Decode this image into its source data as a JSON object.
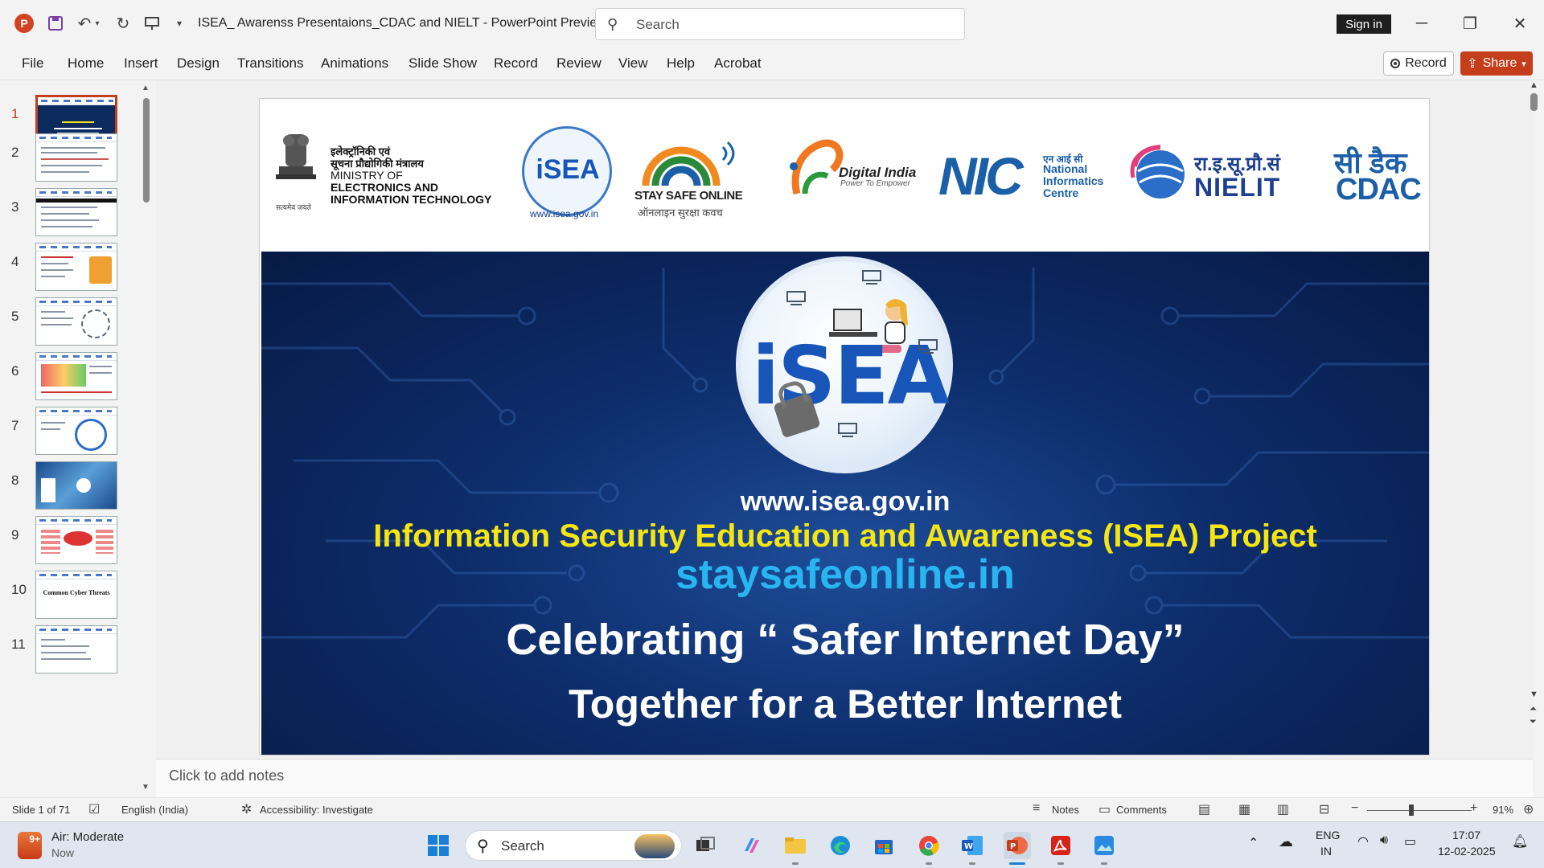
{
  "app": {
    "doc_title": "ISEA_ Awarenss Presentaions_CDAC and NIELT  -  PowerPoint Preview",
    "search_placeholder": "Search",
    "sign_in": "Sign in",
    "logo_letter": "P"
  },
  "ribbon": {
    "tabs": [
      "File",
      "Home",
      "Insert",
      "Design",
      "Transitions",
      "Animations",
      "Slide Show",
      "Record",
      "Review",
      "View",
      "Help",
      "Acrobat"
    ],
    "record_label": "Record",
    "share_label": "Share"
  },
  "thumbnails": {
    "numbers": [
      "1",
      "2",
      "3",
      "4",
      "5",
      "6",
      "7",
      "8",
      "9",
      "10",
      "11"
    ],
    "slide10_title": "Common Cyber Threats"
  },
  "slide": {
    "logos": {
      "ministry_hi1": "इलेक्ट्रॉनिकी एवं",
      "ministry_hi2": "सूचना प्रौद्योगिकी मंत्रालय",
      "ministry_en1": "MINISTRY OF",
      "ministry_en2": "ELECTRONICS AND",
      "ministry_en3": "INFORMATION TECHNOLOGY",
      "emblem_caption": "सत्यमेव जयते",
      "isea_small": "iSEA",
      "isea_url_small": "www.isea.gov.in",
      "sso_caption": "STAY SAFE ONLINE",
      "sso_caption_hi": "ऑनलाइन सुरक्षा कवच",
      "digital_india": "Digital India",
      "digital_india_sub": "Power To Empower",
      "nic": "NIC",
      "nic_hi": "एन आई सी",
      "nic_en1": "National",
      "nic_en2": "Informatics",
      "nic_en3": "Centre",
      "nielit_hi": "रा.इ.सू.प्रौ.सं",
      "nielit_en": "NIELIT",
      "cdac_hi": "सी डैक",
      "cdac_en": "CDAC"
    },
    "isea_big": "iSEA",
    "url": "www.isea.gov.in",
    "project": "Information Security Education and Awareness (ISEA) Project",
    "sso_url": "staysafeonline.in",
    "celebrate": "Celebrating “ Safer Internet Day”",
    "together": "Together for a Better Internet"
  },
  "notes": {
    "placeholder": "Click to add notes"
  },
  "status": {
    "slide_count": "Slide 1 of 71",
    "language": "English (India)",
    "accessibility": "Accessibility: Investigate",
    "notes": "Notes",
    "comments": "Comments",
    "zoom": "91%"
  },
  "taskbar": {
    "weather_title": "Air: Moderate",
    "weather_sub": "Now",
    "weather_badge": "9+",
    "search": "Search",
    "lang1": "ENG",
    "lang2": "IN",
    "time": "17:07",
    "date": "12-02-2025"
  },
  "colors": {
    "accent": "#c43e1c",
    "slide_bg": "#0d2d6b",
    "project_yellow": "#f5e612",
    "sso_cyan": "#29b6f0"
  }
}
